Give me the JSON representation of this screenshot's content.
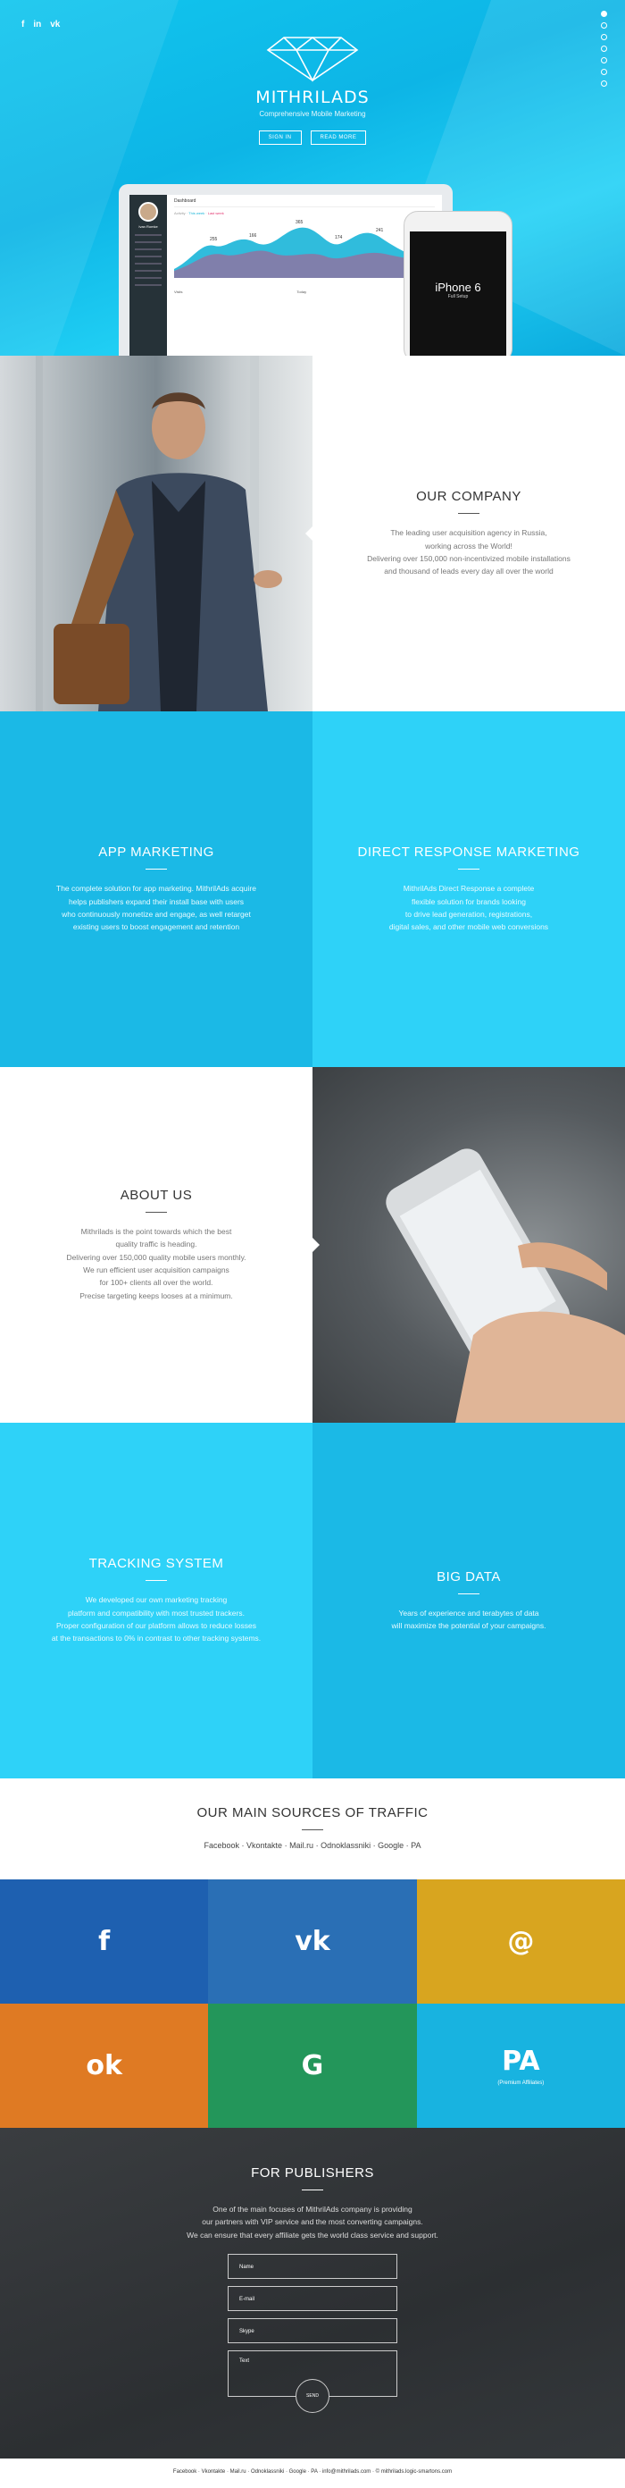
{
  "hero": {
    "social": [
      "f",
      "in",
      "vk"
    ],
    "brand": "MITHRILADS",
    "tagline": "Comprehensive Mobile Marketing",
    "buttons": [
      "SIGN IN",
      "READ MORE"
    ],
    "dashboard": {
      "title": "Dashboard",
      "user": "Ivan Romke",
      "activity_label": "Activity",
      "legend": [
        "This week",
        "Last week"
      ],
      "filters": [
        "Today",
        "Week"
      ],
      "bottom_left": "Visits",
      "bottom_mid": "Today",
      "bottom_right": "Statistics",
      "chart_labels": [
        "255",
        "166",
        "365",
        "174",
        "241"
      ]
    },
    "phone": {
      "model": "iPhone 6",
      "sub": "Full Setup"
    },
    "colors": {
      "accent": "#12c6ee"
    }
  },
  "company": {
    "title": "OUR COMPANY",
    "lines": [
      "The leading user acquisition agency in Russia,",
      "working across the World!",
      "Delivering over 150,000 non-incentivized mobile installations",
      "and thousand of leads every day all over the world"
    ]
  },
  "app_marketing": {
    "title": "APP MARKETING",
    "lines": [
      "The complete solution for app marketing. MithrilAds acquire",
      "helps publishers expand their install base with users",
      "who continuously monetize and engage, as well retarget",
      "existing users to boost engagement and retention"
    ]
  },
  "direct_response": {
    "title": "DIRECT RESPONSE MARKETING",
    "lines": [
      "MithrilAds Direct Response a complete",
      "flexible solution for brands looking",
      "to drive lead generation, registrations,",
      "digital sales, and other mobile web conversions"
    ]
  },
  "about": {
    "title": "ABOUT US",
    "lines": [
      "Mithrilads is the point towards which the best",
      "quality traffic is heading.",
      "Delivering over 150,000 quality mobile users monthly.",
      "We run efficient user acquisition campaigns",
      "for 100+ clients all over the world.",
      "Precise targeting keeps looses at a minimum."
    ]
  },
  "tracking": {
    "title": "TRACKING SYSTEM",
    "lines": [
      "We developed our own marketing tracking",
      "platform and compatibility with most trusted trackers.",
      "Proper configuration of our platform allows to reduce losses",
      "at the transactions to 0% in contrast to other tracking systems."
    ]
  },
  "bigdata": {
    "title": "BIG DATA",
    "lines": [
      "Years of experience and terabytes of data",
      "will maximize the potential of your campaigns."
    ]
  },
  "traffic": {
    "title": "OUR MAIN SOURCES OF TRAFFIC",
    "links": [
      "Facebook",
      "Vkontakte",
      "Mail.ru",
      "Odnoklassniki",
      "Google",
      "PA"
    ],
    "tiles": [
      {
        "glyph": "f",
        "caption": "",
        "color": "#1e60b0"
      },
      {
        "glyph": "vk",
        "caption": "",
        "color": "#2a6fb5"
      },
      {
        "glyph": "@",
        "caption": "",
        "color": "#d8a51f"
      },
      {
        "glyph": "ok",
        "caption": "",
        "color": "#df7a23"
      },
      {
        "glyph": "G",
        "caption": "",
        "color": "#23965a"
      },
      {
        "glyph": "PA",
        "caption": "(Premium Affiliates)",
        "color": "#18b3e0"
      }
    ]
  },
  "publishers": {
    "title": "FOR PUBLISHERS",
    "lines": [
      "One of the main focuses of MithrilAds company is providing",
      "our partners with VIP service and the most converting campaigns.",
      "We can ensure that every affiliate gets the world class service and support."
    ],
    "fields": [
      "Name",
      "E-mail",
      "Skype",
      "Text"
    ],
    "send": "SEND"
  },
  "footer": {
    "text": "Facebook · Vkontakte · Mail.ru · Odnoklassniki · Google · PA · info@mithrilads.com · © mithrilads.logic-smartons.com"
  }
}
